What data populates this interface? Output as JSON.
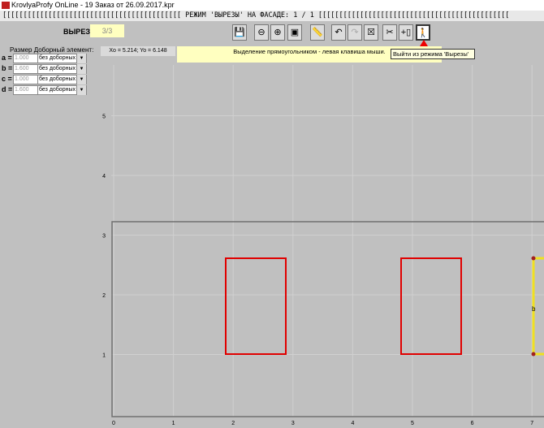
{
  "window": {
    "title": "KrovlyaProfy OnLine - 19 Заказ от 26.09.2017.kpr"
  },
  "mode_bar": {
    "text": "[[[[[[[[[[[[[[[[[[[[[[[[[[[[[[[[[[[[[[[[[[[  РЕЖИМ  'ВЫРЕЗЫ'  НА  ФАСАДЕ: 1 / 1   [[[[[[[[[[[[[[[[[[[[[[[[[[[[[[[[[[[[[[[[[[[[[["
  },
  "cutout": {
    "label": "ВЫРЕЗ:",
    "value": "3/3"
  },
  "panel": {
    "title": "Размер Доборный элемент:",
    "rows": [
      {
        "label": "a =",
        "value": "1.000",
        "option": "без доборных"
      },
      {
        "label": "b =",
        "value": "1.600",
        "option": "без доборных"
      },
      {
        "label": "c =",
        "value": "1.000",
        "option": "без доборных"
      },
      {
        "label": "d =",
        "value": "1.600",
        "option": "без доборных"
      }
    ]
  },
  "toolbar": {
    "buttons": [
      {
        "name": "save-icon",
        "glyph": "💾"
      },
      {
        "name": "zoom-out-icon",
        "glyph": "⊖"
      },
      {
        "name": "zoom-in-icon",
        "glyph": "⊕"
      },
      {
        "name": "fit-icon",
        "glyph": "▣"
      },
      {
        "name": "measure-icon",
        "glyph": "📏"
      },
      {
        "name": "undo-icon",
        "glyph": "↶"
      },
      {
        "name": "redo-icon",
        "glyph": "↷"
      },
      {
        "name": "delete-icon",
        "glyph": "☒"
      },
      {
        "name": "cut-icon",
        "glyph": "✂"
      },
      {
        "name": "add-icon",
        "glyph": "+▯"
      },
      {
        "name": "exit-icon",
        "glyph": "🚶"
      }
    ]
  },
  "status": {
    "coords": "Xo = 5.214;  Yo = 6.148",
    "hint": "Выделение прямоугольником  - левая клавиша мыши."
  },
  "tooltip": "Выйти из режима 'Вырезы'",
  "canvas": {
    "x_ticks": [
      "0",
      "1",
      "2",
      "3",
      "4",
      "5",
      "6",
      "7"
    ],
    "y_ticks": [
      "1",
      "2",
      "3",
      "4",
      "5"
    ],
    "cut_labels": {
      "b": "b"
    },
    "colors": {
      "cutout": "#e00000",
      "selected": "#f0e020",
      "grid": "#d0d0d0",
      "facade": "#707070"
    }
  }
}
